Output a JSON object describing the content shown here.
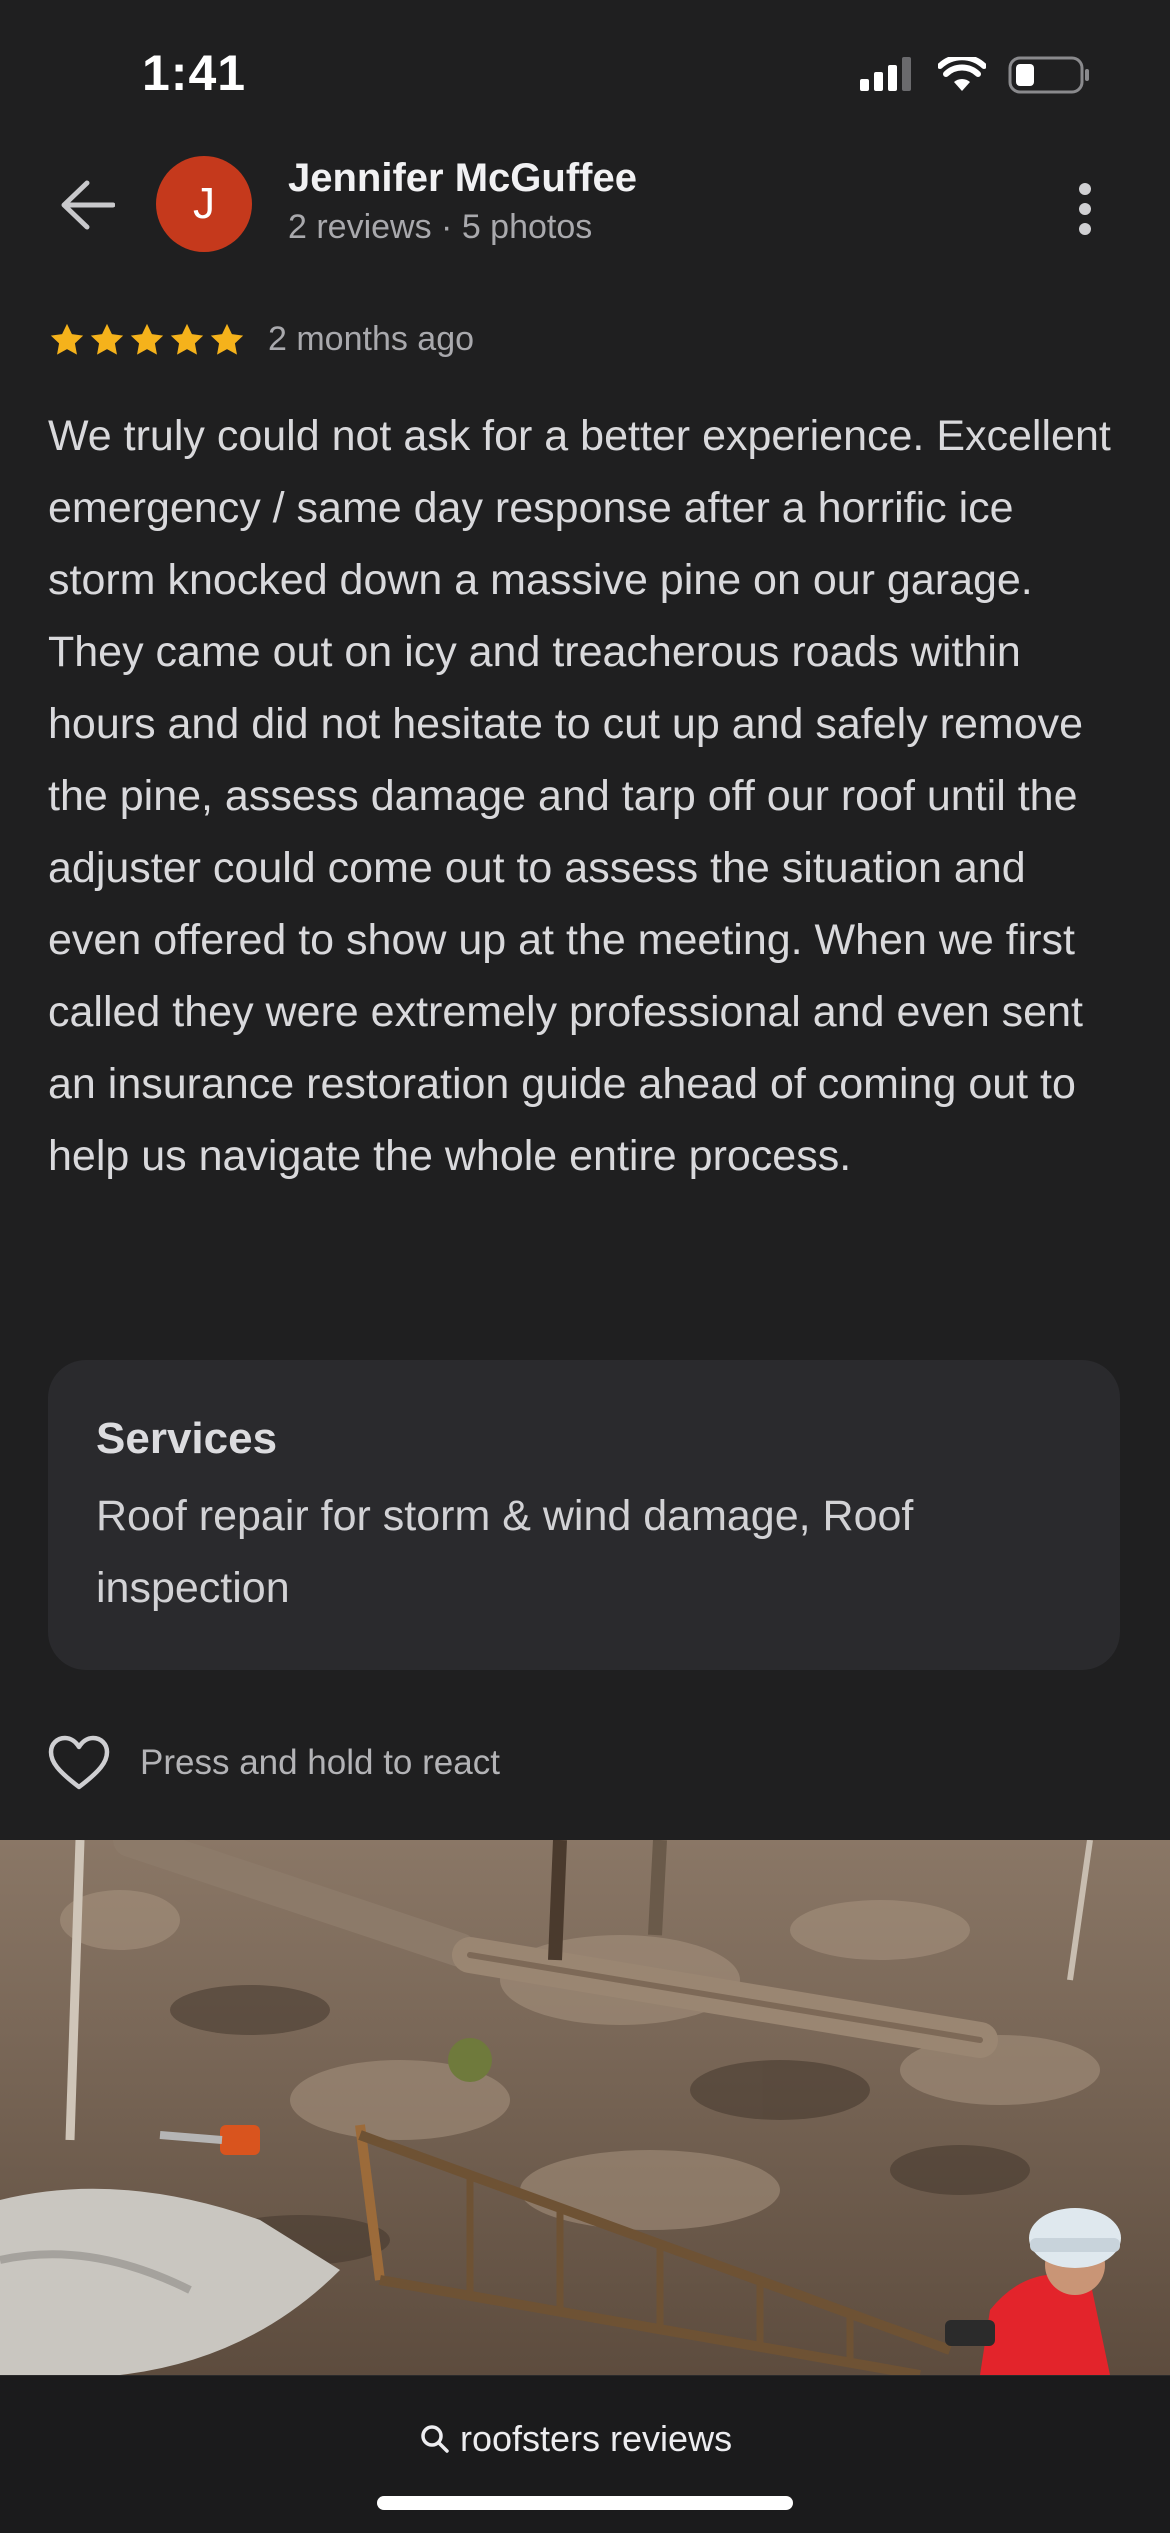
{
  "status_bar": {
    "time": "1:41"
  },
  "header": {
    "avatar_letter": "J",
    "name": "Jennifer McGuffee",
    "meta": "2 reviews · 5 photos"
  },
  "review": {
    "rating": 5,
    "time_ago": "2 months ago",
    "text": "We truly could not ask for a better experience. Excellent emergency / same day response after a horrific ice storm knocked down a massive pine on our garage. They came out on icy and treacherous roads within hours and did not hesitate to cut up and safely remove the pine, assess damage and tarp off our roof until the adjuster could come out to assess the situation and even offered to show up at the meeting. When we first called they were extremely professional and even sent an insurance restoration guide ahead of coming out to help us navigate the whole entire process."
  },
  "services": {
    "title": "Services",
    "value": "Roof repair for storm & wind damage, Roof inspection"
  },
  "react": {
    "label": "Press and hold to react"
  },
  "bottom_bar": {
    "search_text": "roofsters reviews"
  },
  "colors": {
    "background": "#1f1f20",
    "avatar": "#c5391c",
    "star": "#f5b21b",
    "card": "#2a2a2d"
  },
  "icons": [
    "back-arrow-icon",
    "more-vert-icon",
    "star-icon",
    "heart-icon",
    "search-icon",
    "signal-icon",
    "wifi-icon",
    "battery-icon"
  ]
}
